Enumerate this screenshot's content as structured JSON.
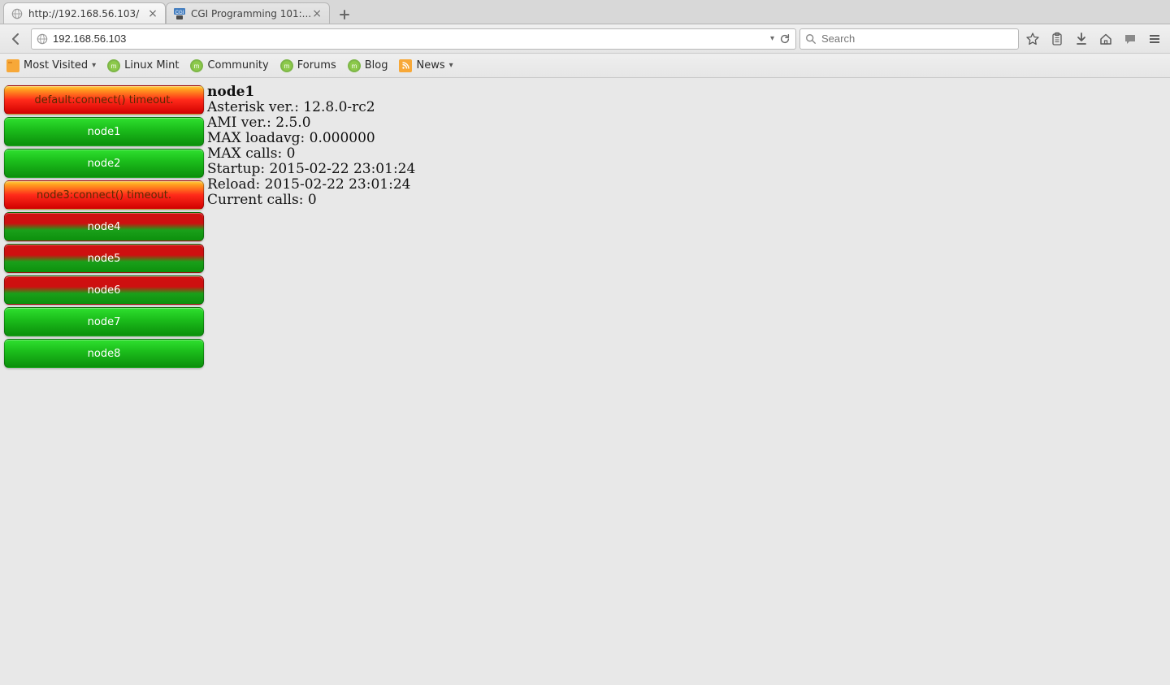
{
  "tabs": {
    "tab0": {
      "title": "http://192.168.56.103/"
    },
    "tab1": {
      "title": "CGI Programming 101:..."
    }
  },
  "url": "192.168.56.103",
  "search": {
    "placeholder": "Search"
  },
  "bookmarks": {
    "mostvisited": "Most Visited",
    "linuxmint": "Linux Mint",
    "community": "Community",
    "forums": "Forums",
    "blog": "Blog",
    "news": "News"
  },
  "nodes": {
    "n0": "default:connect() timeout.",
    "n1": "node1",
    "n2": "node2",
    "n3": "node3:connect() timeout.",
    "n4": "node4",
    "n5": "node5",
    "n6": "node6",
    "n7": "node7",
    "n8": "node8"
  },
  "details": {
    "title": "node1",
    "asterisk": "Asterisk ver.: 12.8.0-rc2",
    "ami": "AMI ver.: 2.5.0",
    "loadavg": "MAX loadavg: 0.000000",
    "maxcalls": "MAX calls: 0",
    "startup": "Startup: 2015-02-22 23:01:24",
    "reload": "Reload: 2015-02-22 23:01:24",
    "current": "Current calls: 0"
  }
}
